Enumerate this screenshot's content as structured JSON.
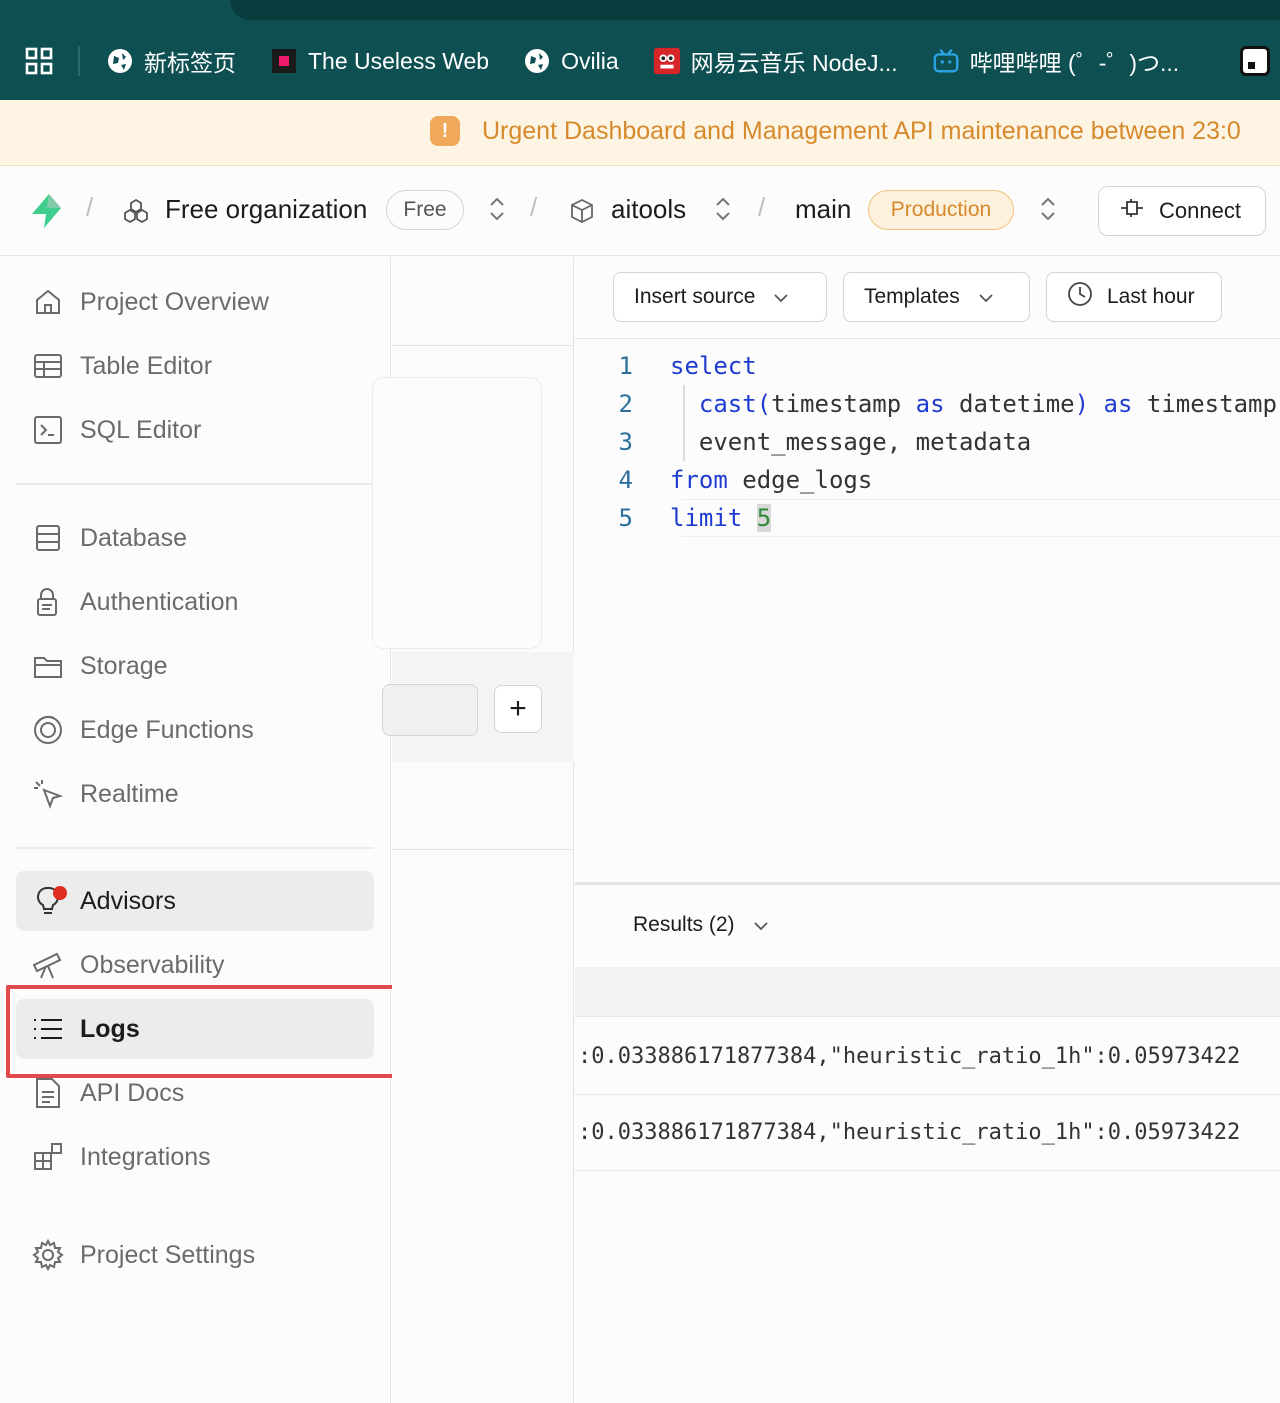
{
  "bookmarks": {
    "items": [
      {
        "label": "新标签页",
        "icon": "globe-icon"
      },
      {
        "label": "The Useless Web",
        "icon": "useless-web-icon"
      },
      {
        "label": "Ovilia",
        "icon": "globe-icon"
      },
      {
        "label": "网易云音乐 NodeJ...",
        "icon": "netease-music-icon"
      },
      {
        "label": "哔哩哔哩 (゜-゜)つ...",
        "icon": "bilibili-icon"
      }
    ]
  },
  "banner": {
    "text": "Urgent Dashboard and Management API maintenance between 23:0",
    "color": "#d68a2c"
  },
  "header": {
    "org_name": "Free organization",
    "org_plan": "Free",
    "project": "aitools",
    "branch": "main",
    "branch_badge": "Production",
    "connect_label": "Connect",
    "brand_color": "#3ecf8e"
  },
  "sidebar": {
    "items": [
      {
        "label": "Project Overview",
        "icon": "home-icon"
      },
      {
        "label": "Table Editor",
        "icon": "table-icon"
      },
      {
        "label": "SQL Editor",
        "icon": "terminal-icon"
      },
      {
        "label": "Database",
        "icon": "database-icon"
      },
      {
        "label": "Authentication",
        "icon": "lock-icon"
      },
      {
        "label": "Storage",
        "icon": "folder-icon"
      },
      {
        "label": "Edge Functions",
        "icon": "edge-functions-icon"
      },
      {
        "label": "Realtime",
        "icon": "cursor-click-icon"
      },
      {
        "label": "Advisors",
        "icon": "lightbulb-icon"
      },
      {
        "label": "Observability",
        "icon": "telescope-icon"
      },
      {
        "label": "Logs",
        "icon": "list-icon"
      },
      {
        "label": "API Docs",
        "icon": "document-icon"
      },
      {
        "label": "Integrations",
        "icon": "blocks-icon"
      },
      {
        "label": "Project Settings",
        "icon": "gear-icon"
      }
    ],
    "active": "Logs"
  },
  "middle": {
    "add_label": "+"
  },
  "editor": {
    "insert_source_label": "Insert source",
    "templates_label": "Templates",
    "time_range_label": "Last hour",
    "lines": [
      {
        "n": "1",
        "tokens": [
          {
            "t": "select",
            "c": "kw"
          }
        ]
      },
      {
        "n": "2",
        "tokens": [
          {
            "t": "  ",
            "c": "tx"
          },
          {
            "t": "cast(",
            "c": "kw"
          },
          {
            "t": "timestamp ",
            "c": "tx"
          },
          {
            "t": "as",
            "c": "kw"
          },
          {
            "t": " datetime",
            "c": "tx"
          },
          {
            "t": ")",
            "c": "kw"
          },
          {
            "t": " ",
            "c": "tx"
          },
          {
            "t": "as",
            "c": "kw"
          },
          {
            "t": " timestamp",
            "c": "tx"
          }
        ]
      },
      {
        "n": "3",
        "tokens": [
          {
            "t": "  event_message, metadata",
            "c": "tx"
          }
        ]
      },
      {
        "n": "4",
        "tokens": [
          {
            "t": "from",
            "c": "kw"
          },
          {
            "t": " edge_logs",
            "c": "tx"
          }
        ]
      },
      {
        "n": "5",
        "tokens": [
          {
            "t": "limit",
            "c": "kw"
          },
          {
            "t": " ",
            "c": "tx"
          },
          {
            "t": "5",
            "c": "cursor-hl"
          }
        ]
      }
    ]
  },
  "results": {
    "label": "Results (2)",
    "rows": [
      ":0.033886171877384,\"heuristic_ratio_1h\":0.05973422",
      ":0.033886171877384,\"heuristic_ratio_1h\":0.05973422"
    ]
  }
}
